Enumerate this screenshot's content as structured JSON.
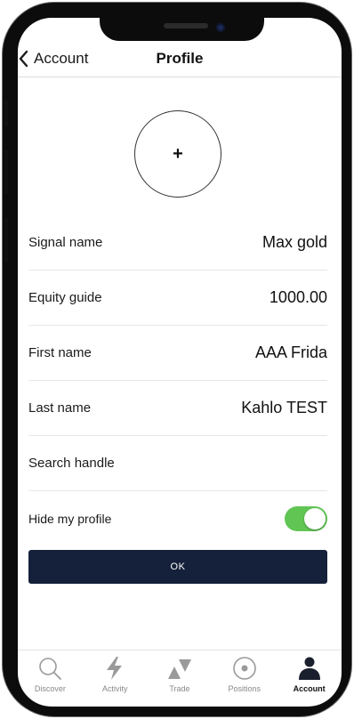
{
  "nav": {
    "back_label": "Account",
    "title": "Profile"
  },
  "avatar": {
    "add_symbol": "+"
  },
  "fields": [
    {
      "label": "Signal name",
      "value": "Max gold"
    },
    {
      "label": "Equity guide",
      "value": "1000.00"
    },
    {
      "label": "First name",
      "value": "AAA Frida"
    },
    {
      "label": "Last name",
      "value": "Kahlo TEST"
    },
    {
      "label": "Search handle",
      "value": ""
    }
  ],
  "hide_profile": {
    "label": "Hide my profile",
    "enabled": true
  },
  "ok_button": {
    "label": "OK"
  },
  "tabs": [
    {
      "label": "Discover",
      "icon": "search-icon",
      "active": false
    },
    {
      "label": "Activity",
      "icon": "lightning-icon",
      "active": false
    },
    {
      "label": "Trade",
      "icon": "trade-arrows-icon",
      "active": false
    },
    {
      "label": "Positions",
      "icon": "target-icon",
      "active": false
    },
    {
      "label": "Account",
      "icon": "person-icon",
      "active": true
    }
  ],
  "colors": {
    "primary_dark": "#15203a",
    "toggle_on": "#61c554"
  }
}
